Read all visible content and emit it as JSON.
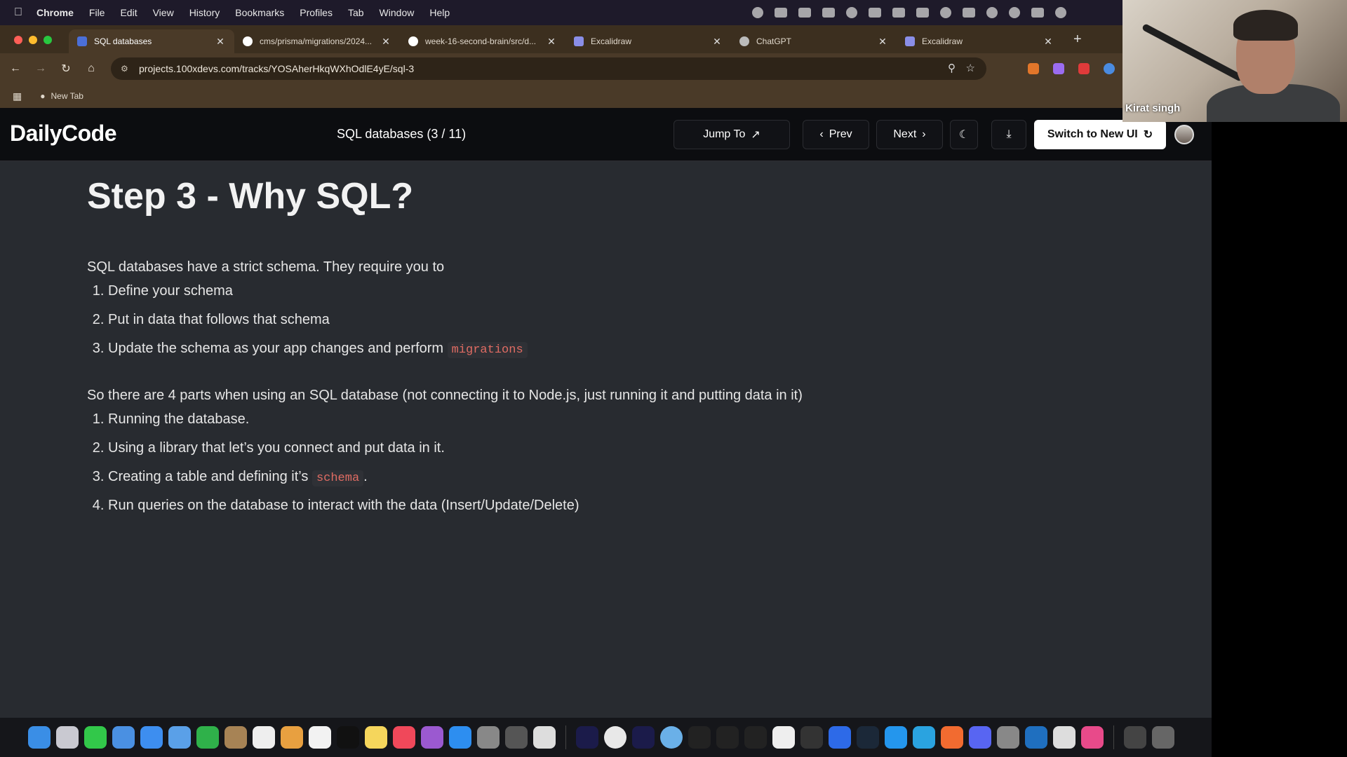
{
  "menubar": {
    "items": [
      "Chrome",
      "File",
      "Edit",
      "View",
      "History",
      "Bookmarks",
      "Profiles",
      "Tab",
      "Window",
      "Help"
    ]
  },
  "browser": {
    "tabs": [
      {
        "title": "SQL databases",
        "active": true
      },
      {
        "title": "cms/prisma/migrations/2024...",
        "active": false
      },
      {
        "title": "week-16-second-brain/src/d...",
        "active": false
      },
      {
        "title": "Excalidraw",
        "active": false
      },
      {
        "title": "ChatGPT",
        "active": false
      },
      {
        "title": "Excalidraw",
        "active": false
      }
    ],
    "url": "projects.100xdevs.com/tracks/YOSAherHkqWXhOdlE4yE/sql-3",
    "bookmarks": [
      {
        "label": "New Tab"
      }
    ]
  },
  "app": {
    "brand": "DailyCode",
    "breadcrumb": "SQL databases (3 / 11)",
    "jump_label": "Jump To",
    "prev_label": "Prev",
    "next_label": "Next",
    "switch_label": "Switch to New UI"
  },
  "content": {
    "heading": "Step 3 - Why SQL?",
    "intro": "SQL databases have a strict schema. They require you to",
    "list1": [
      {
        "text": "Define your schema"
      },
      {
        "text": "Put in data that follows that schema"
      },
      {
        "text": "Update the schema as your app changes and perform ",
        "code": "migrations"
      }
    ],
    "intro2": "So there are 4 parts when using an SQL database (not connecting it to Node.js, just running it and putting data in it)",
    "list2": [
      {
        "text": "Running the database."
      },
      {
        "text": "Using a library that let’s you connect and put data in it."
      },
      {
        "text": "Creating a table and defining it’s ",
        "code": "schema",
        "suffix": "."
      },
      {
        "text": "Run queries on the database to interact with the data (Insert/Update/Delete)"
      }
    ]
  },
  "webcam": {
    "name": "Kirat singh"
  },
  "colors": {
    "page_bg": "#282b30",
    "appbar_bg": "#0c0d10",
    "code_text": "#e06c63",
    "browser_frame": "#4a3a28"
  }
}
